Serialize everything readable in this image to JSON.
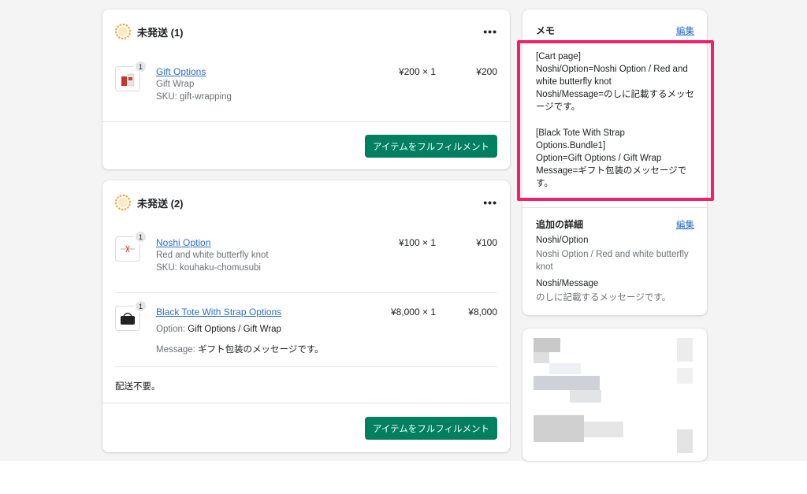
{
  "fulfillment_cards": [
    {
      "title": "未発送 (1)",
      "items": [
        {
          "name": "Gift Options",
          "variant": "Gift Wrap",
          "sku": "SKU: gift-wrapping",
          "qty_badge": "1",
          "unit": "¥200 × 1",
          "total": "¥200"
        }
      ],
      "button_label": "アイテムをフルフィルメント"
    },
    {
      "title": "未発送 (2)",
      "items": [
        {
          "name": "Noshi Option",
          "variant": "Red and white butterfly knot",
          "sku": "SKU: kouhaku-chomusubi",
          "qty_badge": "1",
          "unit": "¥100 × 1",
          "total": "¥100"
        },
        {
          "name": "Black Tote With Strap Options",
          "option_label": "Option:",
          "option_value": "Gift Options / Gift Wrap",
          "message_label": "Message:",
          "message_value": "ギフト包装のメッセージです。",
          "qty_badge": "1",
          "unit": "¥8,000 × 1",
          "total": "¥8,000"
        }
      ],
      "shipping_note": "配送不要。",
      "button_label": "アイテムをフルフィルメント"
    }
  ],
  "sidebar": {
    "memo": {
      "title": "メモ",
      "edit_label": "編集",
      "lines": [
        "[Cart page]",
        "Noshi/Option=Noshi Option / Red and",
        "white butterfly knot",
        "Noshi/Message=のしに記載するメッセ",
        "ージです。",
        "",
        "[Black Tote With Strap",
        "Options.Bundle1]",
        "Option=Gift Options / Gift Wrap",
        "Message=ギフト包装のメッセージで",
        "す。"
      ],
      "highlight_color": "#f0206a"
    },
    "additional_details": {
      "title": "追加の詳細",
      "edit_label": "編集",
      "entries": [
        {
          "key": "Noshi/Option",
          "value_lines": [
            "Noshi Option / Red and white butterfly",
            "knot"
          ]
        },
        {
          "key": "Noshi/Message",
          "value_lines": [
            "のしに記載するメッセージです。"
          ]
        }
      ]
    }
  },
  "colors": {
    "primary_button": "#008060",
    "link": "#2c6ecb",
    "status_unfulfilled": "#e8a33b"
  },
  "icons": [
    "status-unfulfilled-icon",
    "more-actions-icon",
    "product-thumbnail"
  ]
}
